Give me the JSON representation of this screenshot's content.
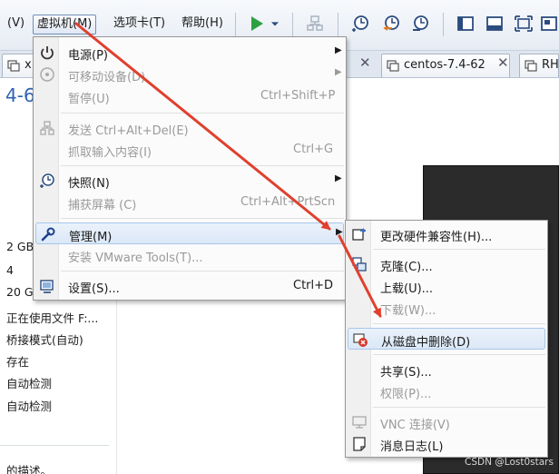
{
  "menubar": {
    "partial_view": "(V)",
    "vm": "虚拟机(M)",
    "tabs": "选项卡(T)",
    "help": "帮助(H)"
  },
  "toolbar_icons": [
    "play-icon",
    "dropdown-arrow-icon",
    "network-icon",
    "snapshot-take-icon",
    "snapshot-revert-icon",
    "snapshot-manager-icon",
    "library-view-icon",
    "console-view-icon",
    "fullscreen-icon",
    "unity-icon"
  ],
  "tab_strip": {
    "tab1_partial": "x",
    "tab2": "centos-7.4-62",
    "tab3_partial": "RH"
  },
  "vm_title_partial": "4-6",
  "details": [
    "2 GB",
    "4",
    "20 G",
    "正在使用文件 F:...",
    "桥接模式(自动)",
    "存在",
    "自动检测",
    "自动检测"
  ],
  "description_partial": "的描述。",
  "vm_menu": {
    "power": "电源(P)",
    "removable": "可移动设备(D)",
    "pause": "暂停(U)",
    "pause_shortcut": "Ctrl+Shift+P",
    "send_cad": "发送 Ctrl+Alt+Del(E)",
    "grab_input": "抓取输入内容(I)",
    "grab_shortcut": "Ctrl+G",
    "snapshot": "快照(N)",
    "capture_screen": "捕获屏幕 (C)",
    "capture_shortcut": "Ctrl+Alt+PrtScn",
    "manage": "管理(M)",
    "install_tools": "安装 VMware Tools(T)...",
    "settings": "设置(S)...",
    "settings_shortcut": "Ctrl+D"
  },
  "manage_menu": {
    "change_hw": "更改硬件兼容性(H)...",
    "clone": "克隆(C)...",
    "upload": "上载(U)...",
    "download": "下载(W)...",
    "delete_from_disk": "从磁盘中删除(D)",
    "share": "共享(S)...",
    "permissions": "权限(P)...",
    "vnc": "VNC 连接(V)",
    "message_log": "消息日志(L)"
  },
  "annotation_color": "#e0402e",
  "watermark": "CSDN @Lost0stars"
}
